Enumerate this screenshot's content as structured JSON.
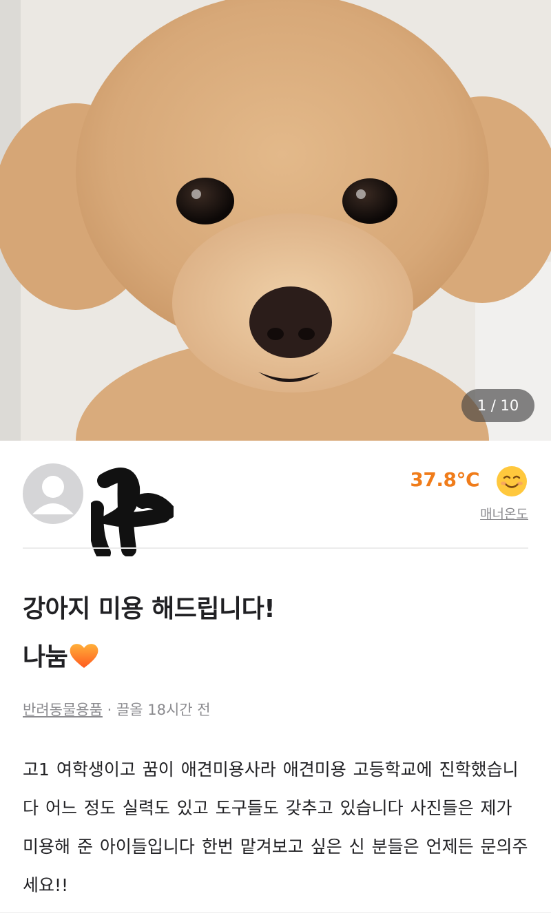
{
  "gallery": {
    "counter": "1 / 10",
    "current_index": 1,
    "total": 10,
    "subject": "fluffy-apricot-poodle-photo"
  },
  "seller": {
    "name_redacted": true,
    "temperature": "37.8°C",
    "temperature_label": "매너온도",
    "temperature_color": "#f07c1a",
    "mood_icon": "smiling-face-icon"
  },
  "post": {
    "title": "강아지 미용 해드립니다!",
    "subtitle": "나눔",
    "subtitle_icon": "orange-heart-icon",
    "category": "반려동물용품",
    "separator": " · ",
    "time": "끌올 18시간 전",
    "description": "고1 여학생이고 꿈이 애견미용사라 애견미용 고등학교에 진학했습니다 어느 정도 실력도 있고 도구들도 갖추고 있습니다 사진들은 제가 미용해 준 아이들입니다 한번 맡겨보고 싶은 신 분들은 언제든 문의주세요!!"
  }
}
